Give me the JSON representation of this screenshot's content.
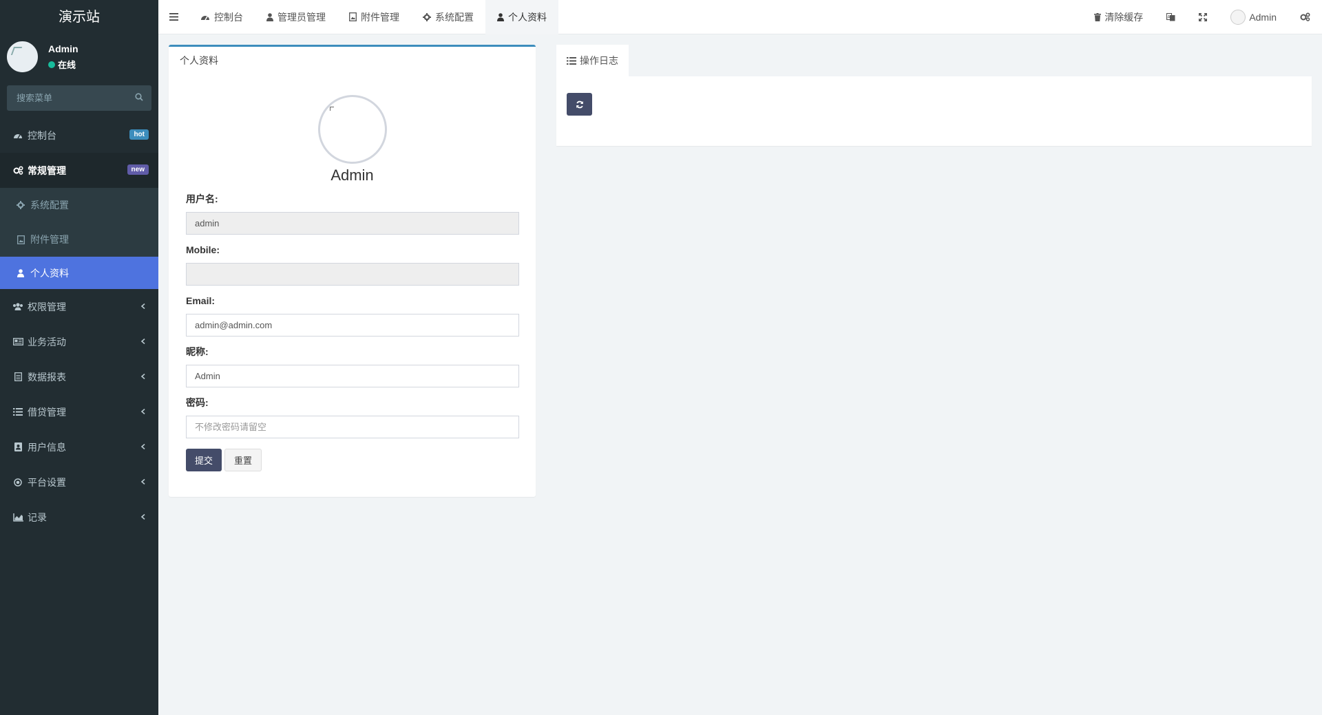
{
  "sidebar": {
    "brand": "演示站",
    "user": {
      "name": "Admin",
      "status": "在线"
    },
    "search": {
      "placeholder": "搜索菜单"
    },
    "items": [
      {
        "label": "控制台",
        "badge": "hot",
        "badge_color": "#3c8dbc"
      },
      {
        "label": "常规管理",
        "badge": "new",
        "badge_color": "#605ca8"
      },
      {
        "label": "系统配置"
      },
      {
        "label": "附件管理"
      },
      {
        "label": "个人资料"
      },
      {
        "label": "权限管理"
      },
      {
        "label": "业务活动"
      },
      {
        "label": "数据报表"
      },
      {
        "label": "借贷管理"
      },
      {
        "label": "用户信息"
      },
      {
        "label": "平台设置"
      },
      {
        "label": "记录"
      }
    ]
  },
  "topnav": {
    "tabs": [
      {
        "label": "控制台"
      },
      {
        "label": "管理员管理"
      },
      {
        "label": "附件管理"
      },
      {
        "label": "系统配置"
      },
      {
        "label": "个人资料"
      }
    ],
    "clear_cache": "清除缓存",
    "user_name": "Admin"
  },
  "profile": {
    "panel_title": "个人资料",
    "name": "Admin",
    "fields": {
      "username": {
        "label": "用户名:",
        "value": "admin"
      },
      "mobile": {
        "label": "Mobile:",
        "value": ""
      },
      "email": {
        "label": "Email:",
        "value": "admin@admin.com"
      },
      "nickname": {
        "label": "昵称:",
        "value": "Admin"
      },
      "password": {
        "label": "密码:",
        "value": "",
        "placeholder": "不修改密码请留空"
      }
    },
    "submit_label": "提交",
    "reset_label": "重置"
  },
  "log": {
    "tab_label": "操作日志"
  },
  "colors": {
    "sidebar_bg": "#222d32",
    "accent": "#4e73df",
    "button_dark": "#444c69",
    "online": "#18bc9c"
  }
}
